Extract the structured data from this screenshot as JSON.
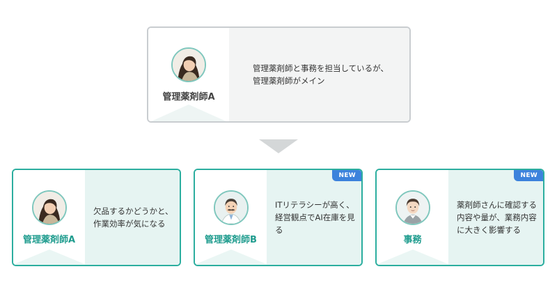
{
  "top_card": {
    "name": "管理薬剤師A",
    "description": "管理薬剤師と事務を担当しているが、\n管理薬剤師がメイン",
    "avatar_icon": "woman-avatar-icon"
  },
  "bottom_cards": [
    {
      "name": "管理薬剤師A",
      "description": "欠品するかどうかと、\n作業効率が気になる",
      "avatar_icon": "woman-avatar-icon",
      "badge": ""
    },
    {
      "name": "管理薬剤師B",
      "description": "ITリテラシーが高く、\n経営観点でAI在庫を見る",
      "avatar_icon": "man-mustache-avatar-icon",
      "badge": "NEW"
    },
    {
      "name": "事務",
      "description": "薬剤師さんに確認する\n内容や量が、業務内容\nに大きく影響する",
      "avatar_icon": "clerk-avatar-icon",
      "badge": "NEW"
    }
  ],
  "colors": {
    "teal": "#2cae9f",
    "grey_border": "#c9cdd0",
    "badge_blue": "#3c82dc",
    "arrow": "#d4d7d8"
  }
}
